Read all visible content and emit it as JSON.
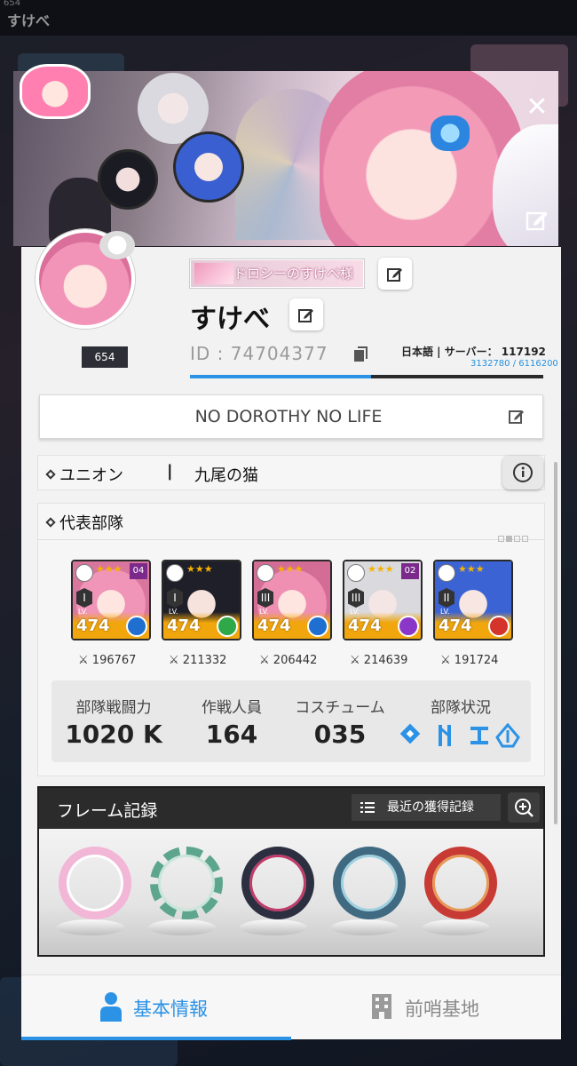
{
  "background": {
    "title": "すけべ",
    "count": "654"
  },
  "profile": {
    "level": "654",
    "title_chip": "ドロシーのすけべ様",
    "name": "すけべ",
    "id_label": "ID : 74704377",
    "language_server": "日本語 | サーバー： 117192",
    "exp_text": "3132780 / 6116200",
    "exp_fraction": 0.512,
    "motto": "NO DOROTHY NO LIFE"
  },
  "union": {
    "label": "ユニオン",
    "separator": "|",
    "value": "九尾の猫"
  },
  "squad": {
    "label": "代表部隊",
    "members": [
      {
        "rank": "I",
        "stars": "★★★",
        "core": "04",
        "level": "474",
        "element": "water",
        "power": "196767"
      },
      {
        "rank": "I",
        "stars": "★★★",
        "core": "",
        "level": "474",
        "element": "wind",
        "power": "211332"
      },
      {
        "rank": "III",
        "stars": "★★★",
        "core": "",
        "level": "474",
        "element": "water",
        "power": "206442"
      },
      {
        "rank": "III",
        "stars": "★★★",
        "core": "02",
        "level": "474",
        "element": "electric",
        "power": "214639"
      },
      {
        "rank": "II",
        "stars": "★★★",
        "core": "",
        "level": "474",
        "element": "fire",
        "power": "191724"
      }
    ],
    "stats": {
      "power_label": "部隊戦闘力",
      "power_value": "1020 K",
      "staff_label": "作戦人員",
      "staff_value": "164",
      "costume_label": "コスチューム",
      "costume_value": "035",
      "status_label": "部隊状況"
    }
  },
  "frames": {
    "title": "フレーム記録",
    "recent_label": "最近の獲得記録"
  },
  "tabs": {
    "basic": "基本情報",
    "outpost": "前哨基地"
  },
  "colors": {
    "accent": "#2b92e6",
    "water": "#1f6fd1",
    "wind": "#2fa84a",
    "electric": "#8a36c9",
    "fire": "#d5342b"
  }
}
